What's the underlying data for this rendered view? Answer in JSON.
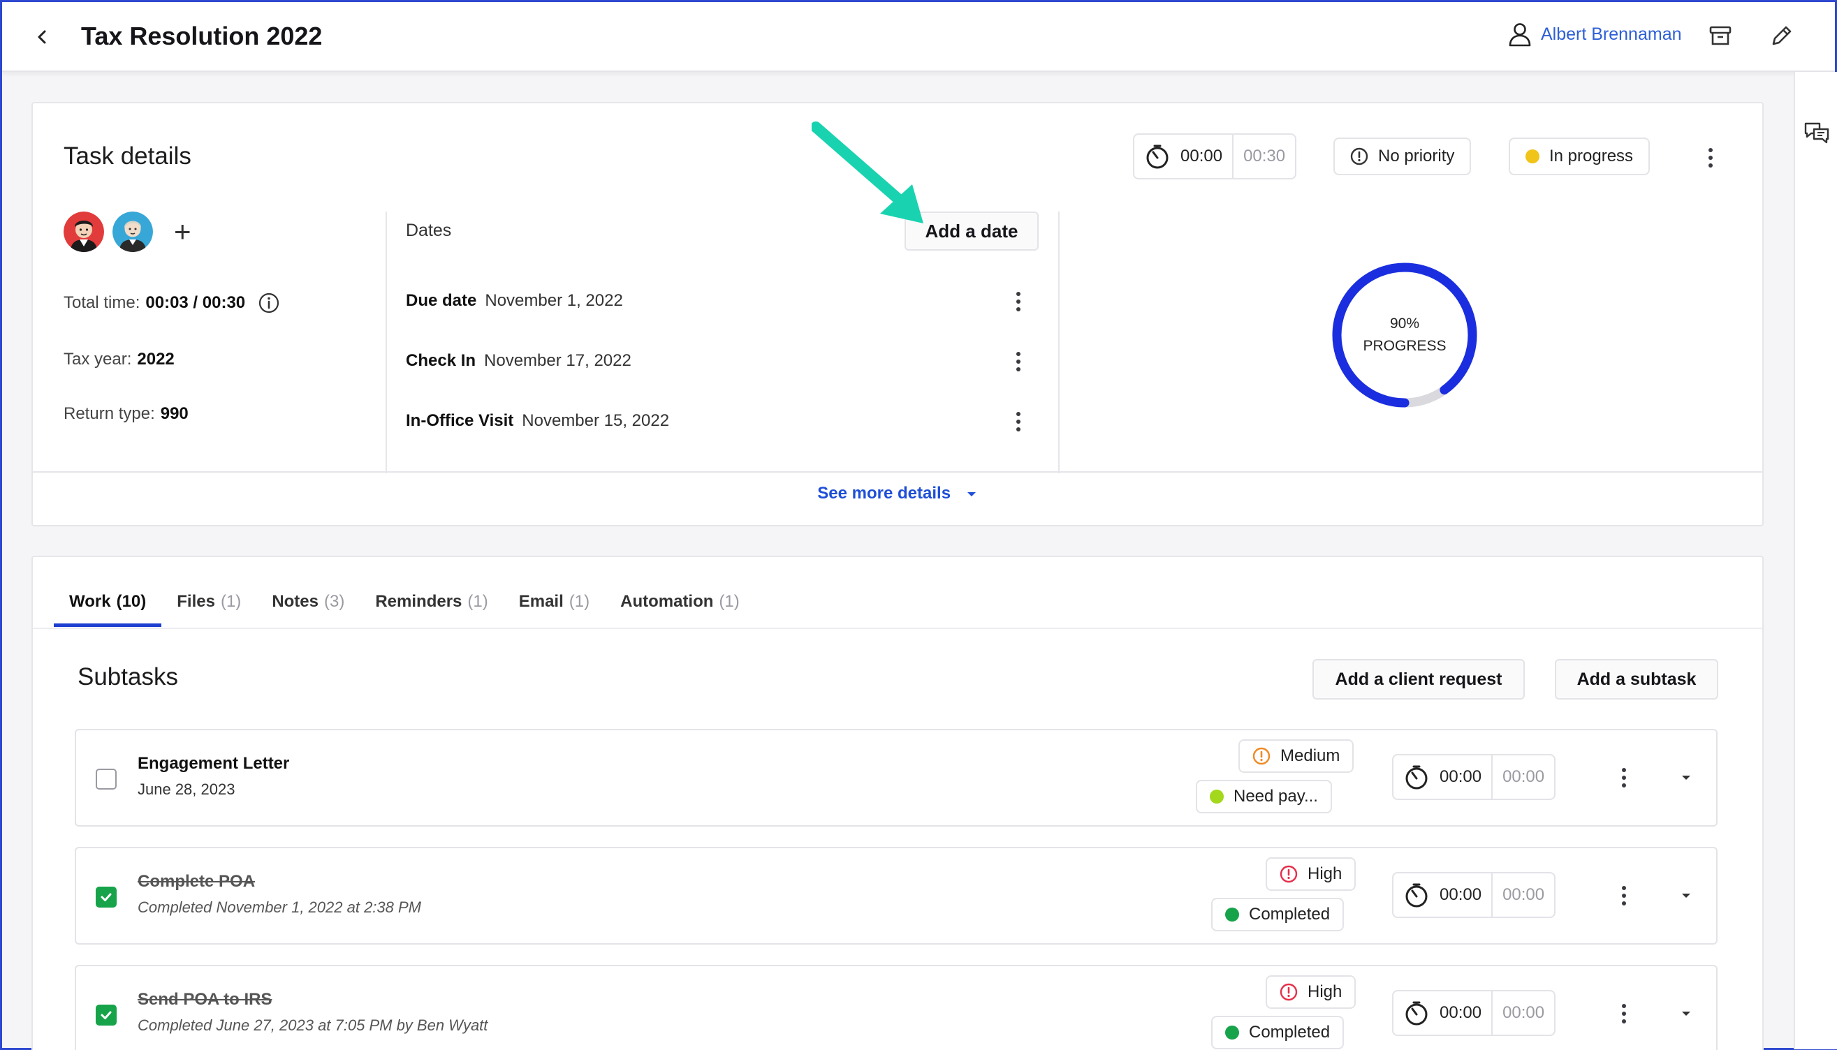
{
  "header": {
    "title": "Tax Resolution 2022",
    "assignee": "Albert Brennaman"
  },
  "colors": {
    "accent": "#1f3fd0",
    "link": "#2d5fd6",
    "status_in_progress": "#f0c419",
    "status_completed": "#17a34a",
    "status_need_payment": "#a3d81c",
    "priority_medium": "#f08a24",
    "priority_high": "#e5304b",
    "annotation_arrow": "#19d3b0"
  },
  "task": {
    "section_title": "Task details",
    "timer": {
      "elapsed": "00:00",
      "estimate": "00:30"
    },
    "priority": "No priority",
    "status": "In progress",
    "total_time_label": "Total time:",
    "total_time_value": "00:03 / 00:30",
    "tax_year_label": "Tax year:",
    "tax_year_value": "2022",
    "return_type_label": "Return type:",
    "return_type_value": "990",
    "dates_label": "Dates",
    "add_date_label": "Add a date",
    "dates": [
      {
        "label": "Due date",
        "value": "November 1, 2022"
      },
      {
        "label": "Check In",
        "value": "November 17, 2022"
      },
      {
        "label": "In-Office Visit",
        "value": "November 15, 2022"
      }
    ],
    "progress": {
      "percent": 90,
      "percent_label": "90%",
      "label": "PROGRESS"
    },
    "see_more": "See more details"
  },
  "tabs": [
    {
      "label": "Work",
      "count": "(10)",
      "active": true
    },
    {
      "label": "Files",
      "count": "(1)"
    },
    {
      "label": "Notes",
      "count": "(3)"
    },
    {
      "label": "Reminders",
      "count": "(1)"
    },
    {
      "label": "Email",
      "count": "(1)"
    },
    {
      "label": "Automation",
      "count": "(1)"
    }
  ],
  "subtasks": {
    "title": "Subtasks",
    "add_client_request": "Add a client request",
    "add_subtask": "Add a subtask",
    "items": [
      {
        "title": "Engagement Letter",
        "subtitle": "June 28, 2023",
        "checked": false,
        "priority": "Medium",
        "status": "Need pay...",
        "timer_elapsed": "00:00",
        "timer_estimate": "00:00"
      },
      {
        "title": "Complete POA",
        "subtitle": "Completed November 1, 2022 at 2:38 PM",
        "checked": true,
        "priority": "High",
        "status": "Completed",
        "timer_elapsed": "00:00",
        "timer_estimate": "00:00"
      },
      {
        "title": "Send POA to IRS",
        "subtitle": "Completed June 27, 2023 at 7:05 PM by Ben Wyatt",
        "checked": true,
        "priority": "High",
        "status": "Completed",
        "timer_elapsed": "00:00",
        "timer_estimate": "00:00"
      }
    ]
  }
}
